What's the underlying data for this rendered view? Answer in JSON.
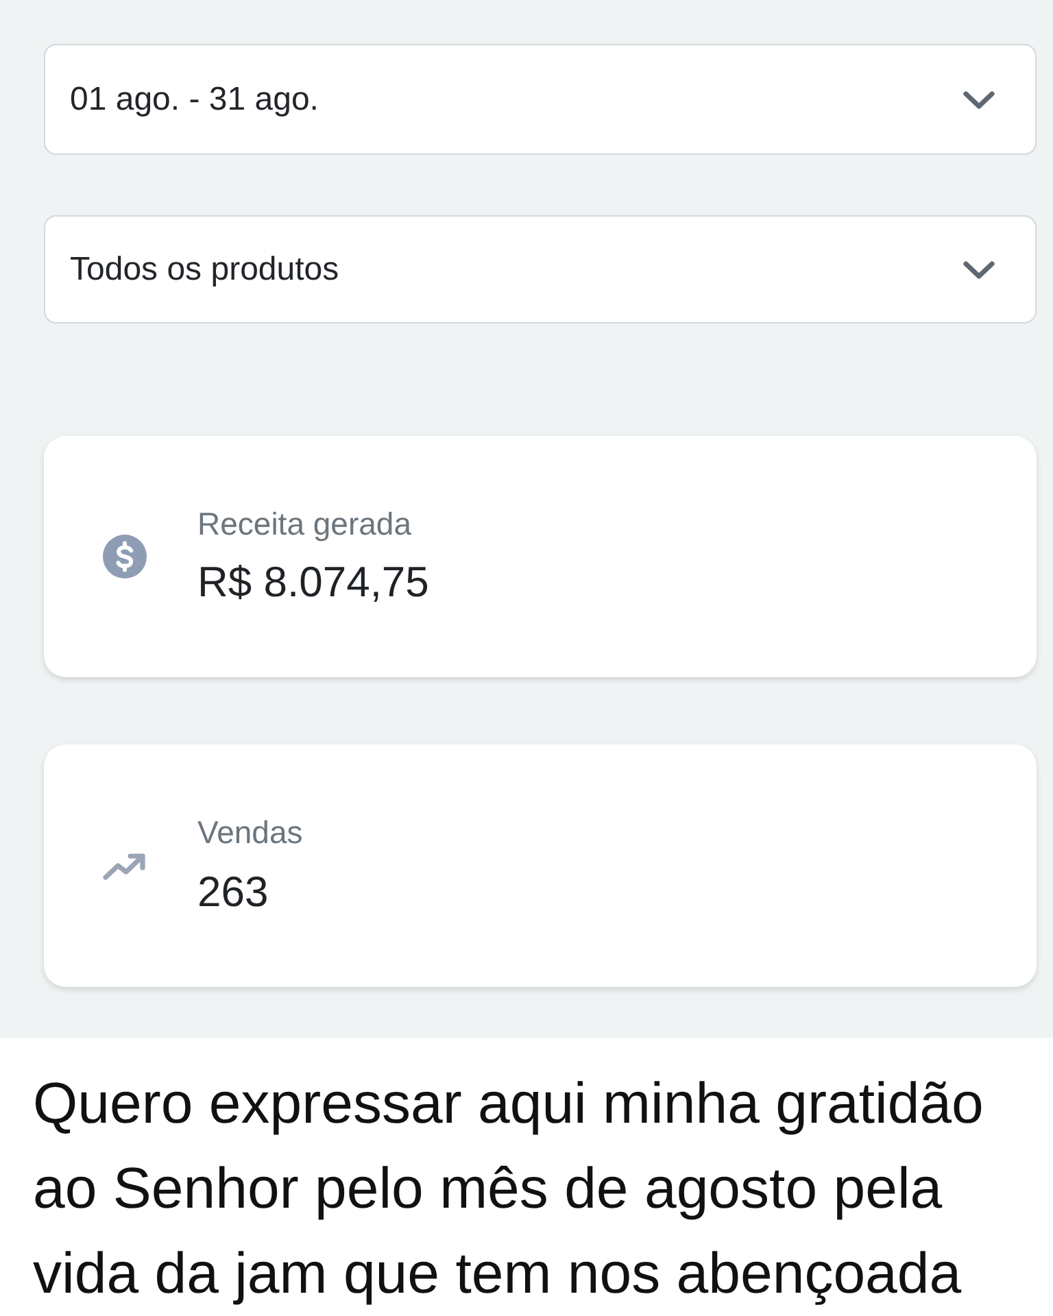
{
  "filters": [
    {
      "value": "01 ago. - 31 ago."
    },
    {
      "value": "Todos os produtos"
    }
  ],
  "stats": [
    {
      "kind": "revenue",
      "label": "Receita gerada",
      "value": "R$ 8.074,75"
    },
    {
      "kind": "sales",
      "label": "Vendas",
      "value": "263"
    }
  ],
  "caption": "Quero expressar aqui minha gratidão ao Senhor pelo mês de agosto pela vida da jam que tem nos abençoada"
}
